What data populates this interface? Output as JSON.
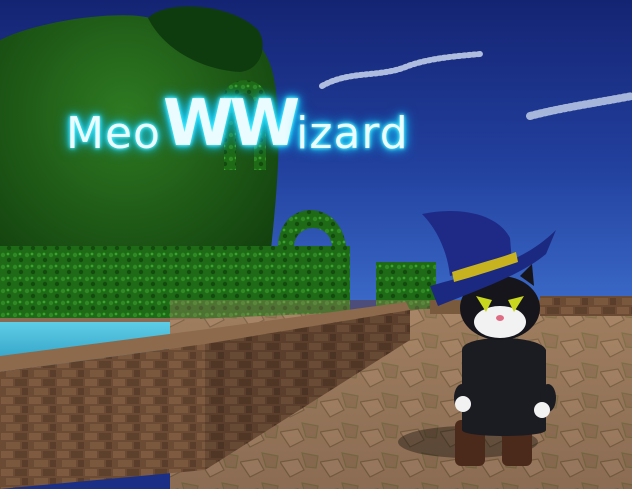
{
  "game": {
    "title_parts": [
      "Meo",
      "WW",
      "izard"
    ]
  },
  "colors": {
    "sky_top": "#16267a",
    "sky_bottom": "#3460c0",
    "glow": "#2ce8ff",
    "hedge": "#1f6a16",
    "water": "#47bbdc",
    "floor": "#8a6a52",
    "wall": "#6c4c35",
    "hat": "#1e2a86",
    "hat_band": "#c7b320",
    "cat_body": "#1b1b22",
    "boots": "#4b2a1c"
  }
}
